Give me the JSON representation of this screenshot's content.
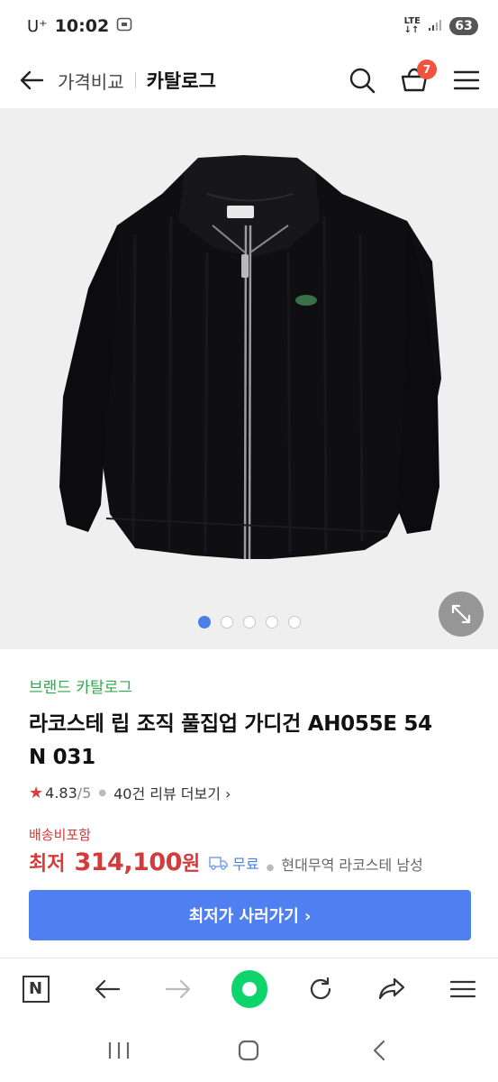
{
  "status_bar": {
    "carrier": "U⁺",
    "time": "10:02",
    "network_top": "LTE",
    "network_bottom": "↓↑",
    "battery": "63"
  },
  "header": {
    "tab_compare": "가격비교",
    "tab_catalog": "카탈로그",
    "cart_count": "7"
  },
  "gallery": {
    "image_icon": "cardigan-image",
    "dot_count": 5,
    "active_index": 0
  },
  "product": {
    "brand_link": "브랜드 카탈로그",
    "title_line1": "라코스테 립 조직 풀집업 가디건 AH055E 54",
    "title_line2": "N 031",
    "rating": "4.83",
    "rating_max": "/5",
    "review_link": "40건 리뷰 더보기 ›",
    "shipping_note": "배송비포함",
    "price_label": "최저",
    "price_value": "314,100",
    "price_unit": "원",
    "free_shipping": "무료",
    "seller": "현대무역 라코스테 남성",
    "buy_button": "최저가 사러가기 ›"
  },
  "colors": {
    "accent_blue": "#4f7ff0",
    "price_red": "#d43b3b",
    "brand_green": "#2fa84f",
    "badge_orange": "#f0533e"
  }
}
